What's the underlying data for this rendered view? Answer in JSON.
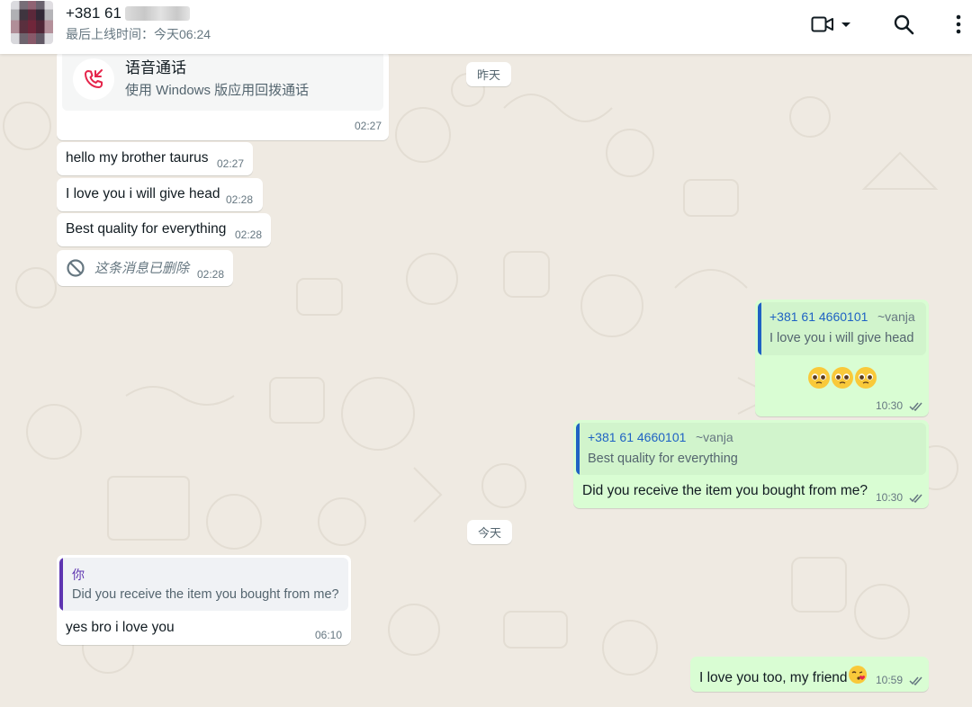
{
  "header": {
    "contact_name": "+381 61",
    "last_seen": "最后上线时间：今天06:24",
    "icons": [
      "video-call-icon",
      "chevron-down-icon",
      "search-icon",
      "menu-icon"
    ]
  },
  "dates": {
    "yesterday": "昨天",
    "today": "今天"
  },
  "messages": {
    "call": {
      "title": "语音通话",
      "subtitle": "使用 Windows 版应用回拨通话",
      "time": "02:27"
    },
    "m1": {
      "text": "hello my brother taurus",
      "time": "02:27"
    },
    "m2": {
      "text": "I love you i will give head",
      "time": "02:28"
    },
    "m3": {
      "text": "Best quality for everything",
      "time": "02:28"
    },
    "m4": {
      "text": "这条消息已删除",
      "time": "02:28"
    },
    "m5": {
      "quote_author": "+381 61 4660101",
      "quote_alias": "~vanja",
      "quote_text": "I love you i will give head",
      "time": "10:30"
    },
    "m6": {
      "quote_author": "+381 61 4660101",
      "quote_alias": "~vanja",
      "quote_text": "Best quality for everything",
      "text": "Did you receive the item you bought from me?",
      "time": "10:30"
    },
    "m7": {
      "quote_author": "你",
      "quote_text": "Did you receive the item you bought from me?",
      "text": "yes bro i love you",
      "time": "06:10"
    },
    "m8": {
      "text": "I love you too, my friend",
      "time": "10:59"
    }
  },
  "colors": {
    "chat_bg": "#efeae2",
    "outgoing_bubble": "#d9fdd3",
    "incoming_bubble": "#ffffff",
    "quote_author_other": "#1f62c4",
    "quote_author_self": "#5e35b1",
    "read_ticks": "#667781",
    "missed_call": "#e5254b"
  }
}
